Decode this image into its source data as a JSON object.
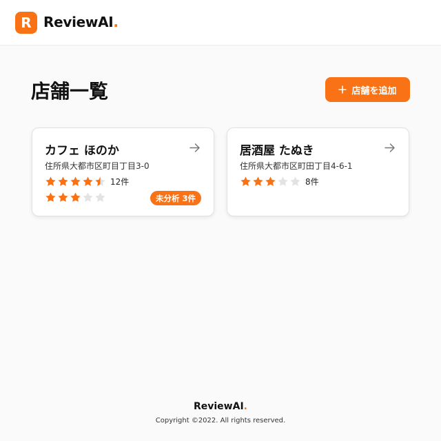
{
  "header": {
    "logo_letter": "R",
    "brand_name": "ReviewAI",
    "brand_dot": "."
  },
  "page": {
    "title": "店舗一覧",
    "add_button_label": "店舗を追加",
    "add_icon": "plus-icon"
  },
  "stores": [
    {
      "name": "カフェ ほのか",
      "address": "住所県大都市区町目丁目3-0",
      "rating": 4.5,
      "review_count": "12件",
      "secondary_rating": 3,
      "badge": "未分析 3件",
      "icon": "arrow-right-icon"
    },
    {
      "name": "居酒屋 たぬき",
      "address": "住所県大都市区町田丁目4-6-1",
      "rating": 3,
      "review_count": "8件",
      "icon": "arrow-right-icon"
    }
  ],
  "footer": {
    "brand_name": "ReviewAI",
    "brand_dot": ".",
    "copyright": "Copyright ©2022. All rights reserved."
  },
  "colors": {
    "accent": "#F97316",
    "star_filled": "#F97316",
    "star_empty": "#E3E3E3",
    "text": "#111111",
    "background": "#FAFAFA"
  }
}
